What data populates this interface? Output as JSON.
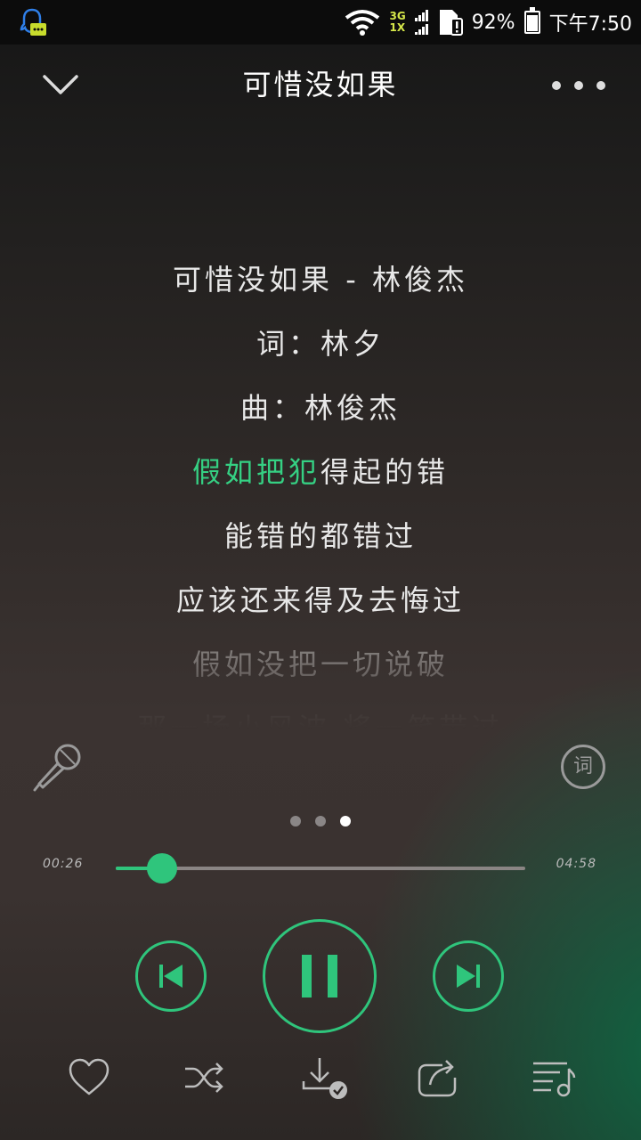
{
  "status_bar": {
    "net_top": "3G",
    "net_bottom": "1X",
    "battery_percent": "92%",
    "battery_level": 92,
    "time": "下午7:50"
  },
  "header": {
    "title": "可惜没如果"
  },
  "lyrics": [
    {
      "text": "可惜没如果 - 林俊杰",
      "state": "normal"
    },
    {
      "text": "词：林夕",
      "state": "normal"
    },
    {
      "text": "曲：林俊杰",
      "state": "normal"
    },
    {
      "sung": "假如把犯",
      "rest": "得起的错",
      "state": "current"
    },
    {
      "text": "能错的都错过",
      "state": "normal"
    },
    {
      "text": "应该还来得及去悔过",
      "state": "normal"
    },
    {
      "text": "假如没把一切说破",
      "state": "dim"
    },
    {
      "text": "那一场小风波 将一笑带过",
      "state": "dimmer"
    }
  ],
  "lyric_button_label": "词",
  "pager": {
    "count": 3,
    "active": 2
  },
  "player": {
    "current_time": "00:26",
    "total_time": "04:58",
    "progress_fraction": 0.112
  },
  "colors": {
    "accent": "#2fc57c",
    "highlight_lyric": "#35d083"
  },
  "icons": {
    "back": "chevron-down-icon",
    "more": "more-dots-icon",
    "mic": "microphone-icon",
    "prev": "skip-previous-icon",
    "pause": "pause-icon",
    "next": "skip-next-icon",
    "favorite": "heart-icon",
    "shuffle": "shuffle-icon",
    "download": "download-icon",
    "share": "share-icon",
    "playlist": "playlist-icon"
  }
}
